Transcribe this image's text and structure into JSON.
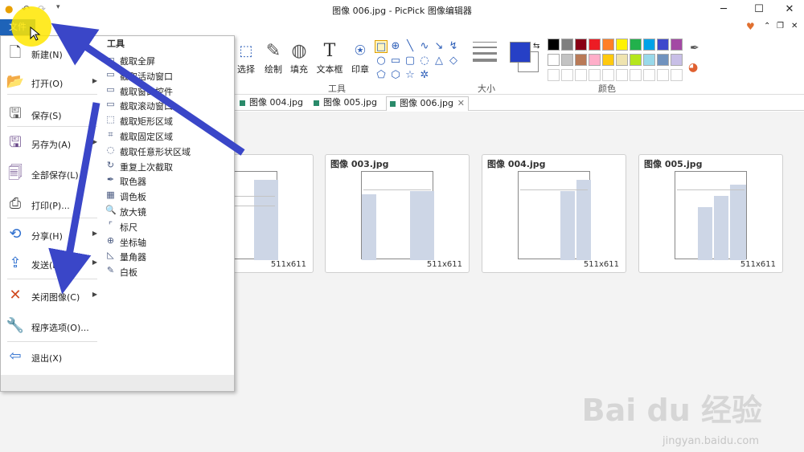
{
  "window": {
    "title": "图像 006.jpg - PicPick 图像编辑器",
    "controls": [
      "─",
      "☐",
      "✕"
    ]
  },
  "file_tab": "文件",
  "ribbon": {
    "buttons": [
      {
        "label": "选择",
        "icon": "select-rect-icon"
      },
      {
        "label": "绘制",
        "icon": "brush-icon"
      },
      {
        "label": "填充",
        "icon": "bucket-icon"
      },
      {
        "label": "文本框",
        "icon": "text-icon"
      },
      {
        "label": "印章",
        "icon": "stamp-icon"
      }
    ],
    "group_tools": "工具",
    "group_size": "大小",
    "group_color": "颜色",
    "primary_color": "#2640c6",
    "palette": [
      "#000000",
      "#7f7f7f",
      "#880015",
      "#ed1c24",
      "#ff7f27",
      "#fff200",
      "#22b14c",
      "#00a2e8",
      "#3f48cc",
      "#a349a4",
      "#ffffff",
      "#c3c3c3",
      "#b97a57",
      "#ffaec9",
      "#ffc90e",
      "#efe4b0",
      "#b5e61d",
      "#99d9ea",
      "#7092be",
      "#c8bfe7"
    ]
  },
  "doc_tabs": [
    {
      "label": "图像 004.jpg"
    },
    {
      "label": "图像 005.jpg"
    },
    {
      "label": "图像 006.jpg"
    }
  ],
  "thumbnails": [
    {
      "name": "",
      "size": "511x611"
    },
    {
      "name": "图像 003.jpg",
      "size": "511x611"
    },
    {
      "name": "图像 004.jpg",
      "size": "511x611"
    },
    {
      "name": "图像 005.jpg",
      "size": "511x611"
    }
  ],
  "thumb_bottom_size": "511x611",
  "file_menu": {
    "items": [
      {
        "label": "新建(N)",
        "icon": "new-file-icon",
        "arrow": false
      },
      {
        "label": "打开(O)",
        "icon": "open-folder-icon",
        "arrow": true
      },
      {
        "label": "保存(S)",
        "icon": "save-icon",
        "arrow": false
      },
      {
        "label": "另存为(A)",
        "icon": "save-as-icon",
        "arrow": true
      },
      {
        "label": "全部保存(L)...",
        "icon": "save-all-icon",
        "arrow": false
      },
      {
        "label": "打印(P)...",
        "icon": "printer-icon",
        "arrow": false
      },
      {
        "label": "分享(H)",
        "icon": "share-icon",
        "arrow": true
      },
      {
        "label": "发送(D)",
        "icon": "send-icon",
        "arrow": true
      },
      {
        "label": "关闭图像(C)",
        "icon": "close-x-icon",
        "arrow": true
      },
      {
        "label": "程序选项(O)...",
        "icon": "wrench-icon",
        "arrow": false
      },
      {
        "label": "退出(X)",
        "icon": "exit-icon",
        "arrow": false
      }
    ],
    "tools_header": "工具",
    "tools": [
      "截取全屏",
      "截取活动窗口",
      "截取窗口控件",
      "截取滚动窗口",
      "截取矩形区域",
      "截取固定区域",
      "截取任意形状区域",
      "重复上次截取",
      "取色器",
      "调色板",
      "放大镜",
      "标尺",
      "坐标轴",
      "量角器",
      "白板"
    ]
  },
  "watermark": {
    "brand": "Bai du 经验",
    "url": "jingyan.baidu.com"
  }
}
